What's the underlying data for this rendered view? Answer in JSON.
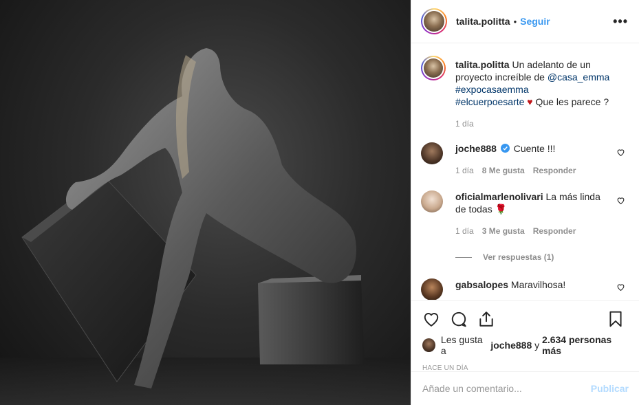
{
  "post": {
    "username": "talita.politta",
    "dot": "•",
    "follow_label": "Seguir",
    "more_label": "•••"
  },
  "caption": {
    "username": "talita.politta",
    "text_1": "Un adelanto de un proyecto increíble de",
    "mention": "@casa_emma",
    "hashtag_1": "#expocasaemma",
    "hashtag_2": "#elcuerpoesarte",
    "emoji": "♥",
    "text_2": "Que les parece ?",
    "time": "1 día"
  },
  "comments": [
    {
      "username": "joche888",
      "verified": true,
      "text": "Cuente !!!",
      "time": "1 día",
      "likes": "8 Me gusta",
      "reply": "Responder"
    },
    {
      "username": "oficialmarlenolivari",
      "text": "La más linda de todas",
      "emoji": "🌹",
      "time": "1 día",
      "likes": "3 Me gusta",
      "reply": "Responder",
      "view_replies": "Ver respuestas (1)"
    },
    {
      "username": "gabsalopes",
      "text": "Maravilhosa!"
    }
  ],
  "likes": {
    "prefix": "Les gusta a",
    "user": "joche888",
    "conj": "y",
    "others": "2.634 personas más"
  },
  "timestamp": "HACE UN DÍA",
  "add_comment": {
    "placeholder": "Añade un comentario...",
    "publish_label": "Publicar"
  },
  "colors": {
    "follow": "#3897f0",
    "link": "#003569",
    "heart": "#c0171b",
    "publish_disabled": "#b3dbff"
  },
  "icons": [
    "heart-icon",
    "comment-icon",
    "share-icon",
    "bookmark-icon",
    "more-icon",
    "verified-icon"
  ]
}
